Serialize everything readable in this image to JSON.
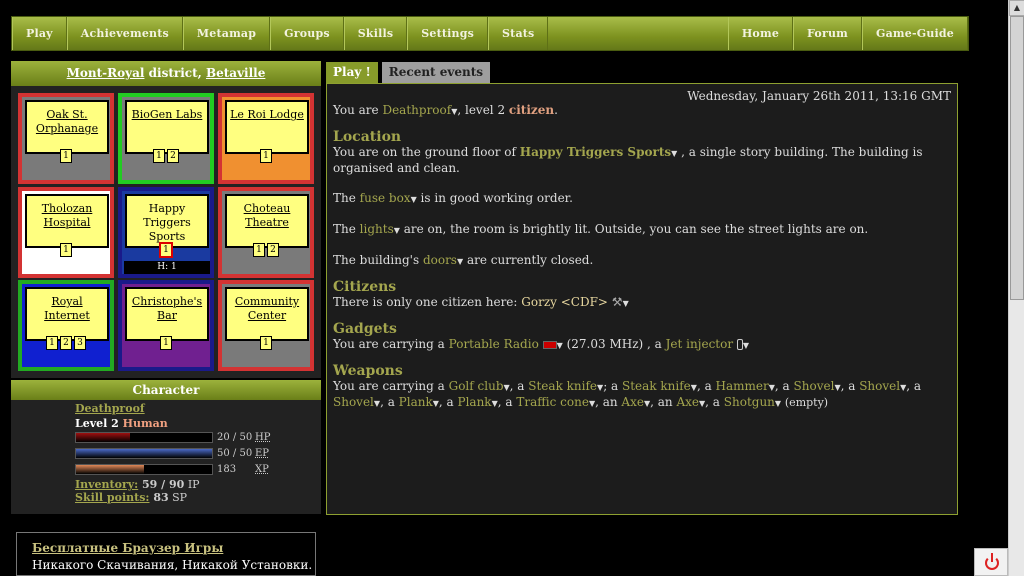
{
  "nav": {
    "left": [
      "Play",
      "Achievements",
      "Metamap",
      "Groups",
      "Skills",
      "Settings",
      "Stats"
    ],
    "right": [
      "Home",
      "Forum",
      "Game-Guide"
    ]
  },
  "district": {
    "district": "Mont-Royal",
    "district_suffix": " district, ",
    "city": "Betaville"
  },
  "map": [
    {
      "name": "Oak St. Orphanage",
      "border": "#d33333",
      "bg": "#7a7a7a",
      "nums": [
        "1"
      ],
      "linked": true
    },
    {
      "name": "BioGen Labs",
      "border": "#22cc22",
      "bg": "#7a7a7a",
      "nums": [
        "1",
        "2"
      ],
      "linked": true
    },
    {
      "name": "Le Roi Lodge",
      "border": "#d33333",
      "bg": "#f09030",
      "nums": [
        "1"
      ],
      "linked": true
    },
    {
      "name": "Tholozan Hospital",
      "border": "#d33333",
      "bg": "#ffffff",
      "nums": [
        "1"
      ],
      "linked": true
    },
    {
      "name": "Happy Triggers Sports",
      "border": "#1a1a8a",
      "bg": "#1a3aa0",
      "nums": [
        "1"
      ],
      "linked": false,
      "current": true,
      "h": "H: 1"
    },
    {
      "name": "Choteau Theatre",
      "border": "#d33333",
      "bg": "#7a7a7a",
      "nums": [
        "1",
        "2"
      ],
      "linked": true
    },
    {
      "name": "Royal Internet",
      "border": "#22aa22",
      "bg": "#1020d0",
      "nums": [
        "1",
        "2",
        "3"
      ],
      "linked": true
    },
    {
      "name": "Christophe's Bar",
      "border": "#1a1a8a",
      "bg": "#702090",
      "nums": [
        "1"
      ],
      "linked": true
    },
    {
      "name": "Community Center",
      "border": "#d33333",
      "bg": "#7a7a7a",
      "nums": [
        "1"
      ],
      "linked": true
    }
  ],
  "character": {
    "header": "Character",
    "name": "Deathproof",
    "level_prefix": "Level 2 ",
    "race": "Human",
    "stats": [
      {
        "value": "20 / 50",
        "label": "HP",
        "fraction": 0.4,
        "color": "#a01010"
      },
      {
        "value": "50 / 50",
        "label": "EP",
        "fraction": 1.0,
        "color": "#4a6ac8"
      },
      {
        "value": "183",
        "label": "XP",
        "fraction": 0.5,
        "color": "#e08858"
      }
    ],
    "inventory_label": "Inventory:",
    "inventory_value": " 59 / 90",
    "inventory_unit": " IP",
    "skill_label": "Skill points:",
    "skill_value": " 83",
    "skill_unit": " SP"
  },
  "ad": {
    "title": "Бесплатные Браузер Игры",
    "desc": "Никакого Скачивания, Никакой Установки."
  },
  "tabs": {
    "active": "Play !",
    "inactive": "Recent events"
  },
  "main": {
    "date": "Wednesday, January 26th 2011, 13:16 GMT",
    "you_are": "You are ",
    "player": "Deathproof",
    "level_text": ", level 2 ",
    "rank": "citizen",
    "location_h": "Location",
    "loc_text1": "You are on the ground floor of ",
    "building": "Happy Triggers Sports",
    "loc_text2": " , a single story building. The building is organised and clean.",
    "the": "The ",
    "fusebox": "fuse box",
    "fusebox_text": " is in good working order.",
    "lights": "lights",
    "lights_text": " are on, the room is brightly lit. Outside, you can see the street lights are on.",
    "doors_pre": "The building's ",
    "doors": "doors",
    "doors_text": " are currently closed.",
    "citizens_h": "Citizens",
    "citizens_text": "There is only one citizen here: ",
    "citizen": "Gorzy <CDF>",
    "gadgets_h": "Gadgets",
    "gadgets_pre": "You are carrying a ",
    "radio": "Portable Radio",
    "radio_freq": " (27.03 MHz) , a ",
    "injector": "Jet injector",
    "weapons_h": "Weapons",
    "weapons_pre": "You are carrying a ",
    "weapons": [
      "Golf club",
      "Steak knife",
      "Steak knife",
      "Hammer",
      "Shovel",
      "Shovel",
      "Shovel",
      "Plank",
      "Plank",
      "Traffic cone",
      "Axe",
      "Axe",
      "Shotgun"
    ],
    "shotgun_note": "(empty)"
  }
}
